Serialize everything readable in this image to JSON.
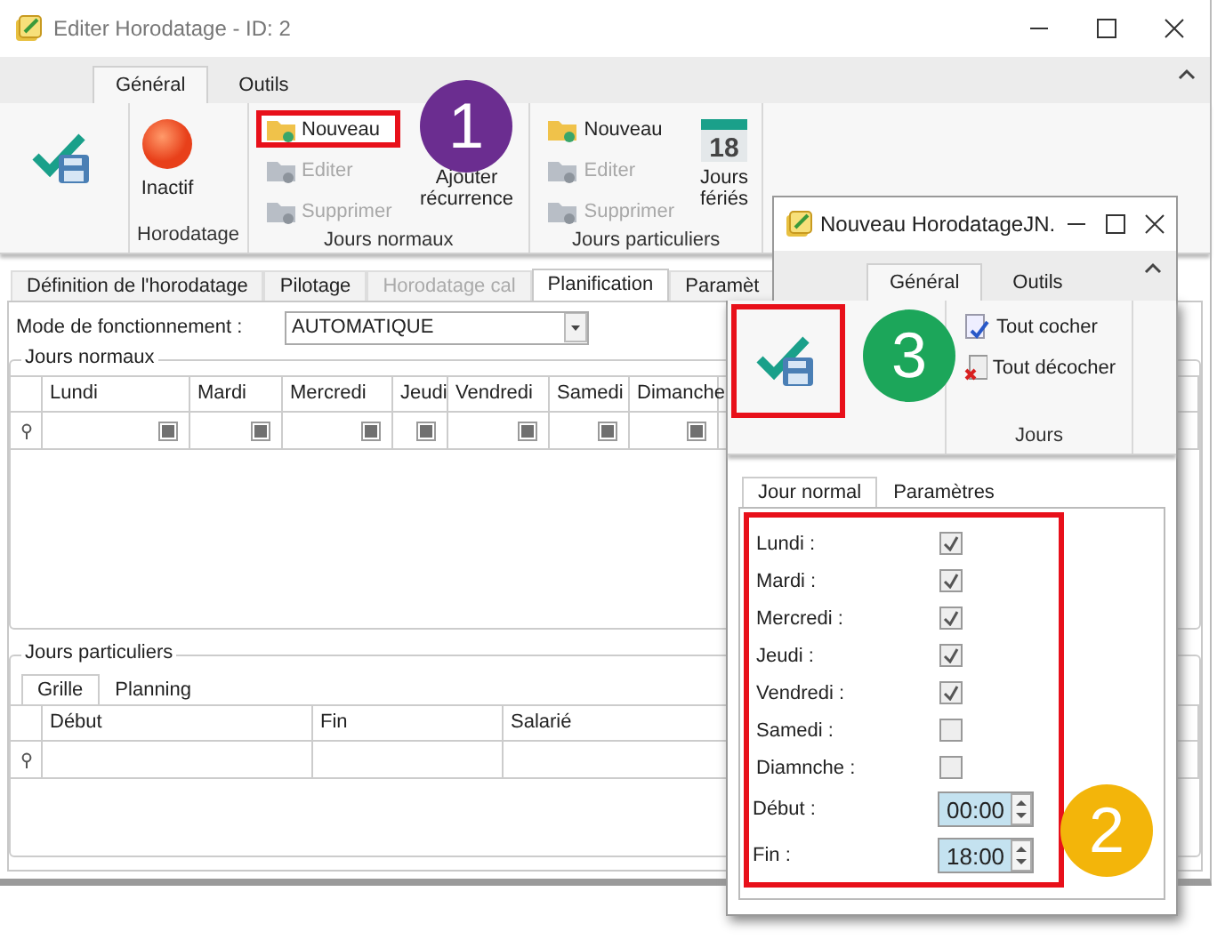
{
  "window": {
    "title": "Editer Horodatage - ID: 2"
  },
  "ribbon": {
    "tabs": [
      {
        "label": "Général",
        "selected": true
      },
      {
        "label": "Outils",
        "selected": false
      }
    ],
    "groups": [
      {
        "items": [
          {
            "kind": "save"
          }
        ]
      },
      {
        "label": "Horodatage",
        "items": [
          {
            "kind": "record",
            "label": "Inactif"
          }
        ]
      },
      {
        "label": "Jours normaux",
        "items": [
          {
            "kind": "small",
            "label": "Nouveau",
            "disabled": false,
            "highlighted": true
          },
          {
            "kind": "small",
            "label": "Editer",
            "disabled": true,
            "highlighted": false
          },
          {
            "kind": "small",
            "label": "Supprimer",
            "disabled": true,
            "highlighted": false
          },
          {
            "kind": "recurrence",
            "label": "Ajouter récurrence"
          }
        ]
      },
      {
        "label": "Jours particuliers",
        "items": [
          {
            "kind": "small",
            "label": "Nouveau",
            "disabled": false,
            "highlighted": false
          },
          {
            "kind": "small",
            "label": "Editer",
            "disabled": true,
            "highlighted": false
          },
          {
            "kind": "small",
            "label": "Supprimer",
            "disabled": true,
            "highlighted": false
          },
          {
            "kind": "calendar",
            "label": "Jours fériés",
            "badge": "18"
          }
        ]
      }
    ]
  },
  "tabs": [
    {
      "label": "Définition de l'horodatage",
      "selected": false,
      "disabled": false
    },
    {
      "label": "Pilotage",
      "selected": false,
      "disabled": false
    },
    {
      "label": "Horodatage cal",
      "selected": false,
      "disabled": true
    },
    {
      "label": "Planification",
      "selected": true,
      "disabled": false
    },
    {
      "label": "Paramèt",
      "selected": false,
      "disabled": false
    }
  ],
  "mode": {
    "label": "Mode de fonctionnement :",
    "value": "AUTOMATIQUE"
  },
  "jours_normaux": {
    "title": "Jours normaux",
    "columns": [
      "Lundi",
      "Mardi",
      "Mercredi",
      "Jeudi",
      "Vendredi",
      "Samedi",
      "Dimanche"
    ],
    "rows": [
      {
        "cells": [
          {
            "indeterminate": true
          },
          {
            "indeterminate": true
          },
          {
            "indeterminate": true
          },
          {
            "indeterminate": true
          },
          {
            "indeterminate": true
          },
          {
            "indeterminate": true
          },
          {
            "indeterminate": true
          }
        ]
      }
    ]
  },
  "jours_particuliers": {
    "title": "Jours particuliers",
    "tabs": [
      {
        "label": "Grille",
        "selected": true
      },
      {
        "label": "Planning",
        "selected": false
      }
    ],
    "columns": [
      "Début",
      "Fin",
      "Salarié"
    ]
  },
  "dialog": {
    "title": "Nouveau HorodatageJN.",
    "ribbon": {
      "tabs": [
        {
          "label": "Général",
          "selected": true
        },
        {
          "label": "Outils",
          "selected": false
        }
      ],
      "save": {
        "highlighted": true
      },
      "group": {
        "label": "Jours",
        "items": [
          {
            "kind": "check",
            "label": "Tout cocher"
          },
          {
            "kind": "uncheck",
            "label": "Tout décocher"
          }
        ]
      }
    },
    "tabs": [
      {
        "label": "Jour normal",
        "selected": true
      },
      {
        "label": "Paramètres",
        "selected": false
      }
    ],
    "highlighted": true,
    "days": [
      {
        "label": "Lundi :",
        "checked": true
      },
      {
        "label": "Mardi :",
        "checked": true
      },
      {
        "label": "Mercredi :",
        "checked": true
      },
      {
        "label": "Jeudi :",
        "checked": true
      },
      {
        "label": "Vendredi :",
        "checked": true
      },
      {
        "label": "Samedi :",
        "checked": false
      },
      {
        "label": "Diamnche :",
        "checked": false
      }
    ],
    "times": [
      {
        "label": "Début :",
        "value": "00:00"
      },
      {
        "label": "Fin :",
        "value": "18:00"
      }
    ]
  },
  "callouts": [
    {
      "label": "1",
      "color": "#6b2d90"
    },
    {
      "label": "2",
      "color": "#f3b50a"
    },
    {
      "label": "3",
      "color": "#1ca65a"
    }
  ]
}
